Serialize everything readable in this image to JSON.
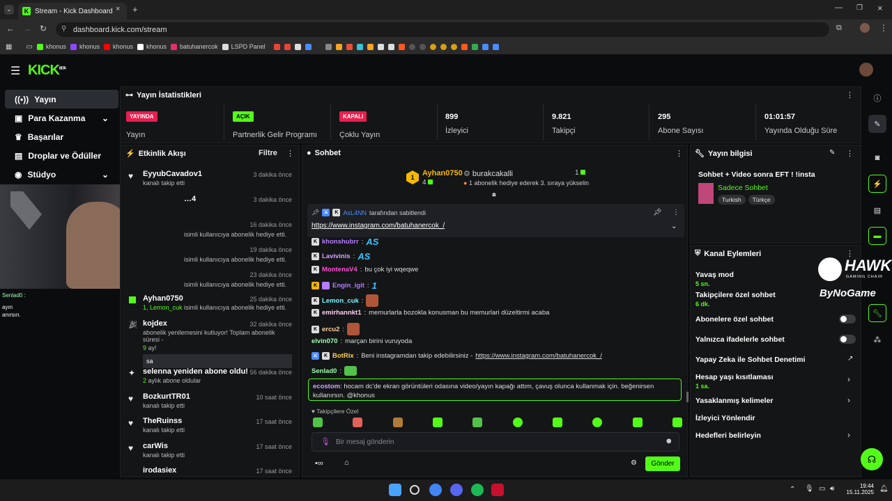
{
  "browser": {
    "tab_title": "Stream - Kick Dashboard",
    "url": "dashboard.kick.com/stream",
    "bookmarks": [
      "khonus",
      "khonus",
      "khonus",
      "khonus",
      "batuhanercok",
      "LSPD Panel"
    ]
  },
  "brand": {
    "logo": "KICK",
    "beta": "BETA"
  },
  "sidebar": {
    "items": [
      {
        "label": "Yayın",
        "icon": "broadcast-icon"
      },
      {
        "label": "Para Kazanma",
        "icon": "money-icon"
      },
      {
        "label": "Başarılar",
        "icon": "trophy-icon"
      },
      {
        "label": "Droplar ve Ödüller",
        "icon": "gift-icon"
      },
      {
        "label": "Stüdyo",
        "icon": "studio-icon"
      }
    ]
  },
  "stats": {
    "title": "Yayın İstatistikleri",
    "items": [
      {
        "badge": "YAYINDA",
        "label": "Yayın",
        "color": "#e91e4f"
      },
      {
        "badge": "AÇIK",
        "label": "Partnerlik Gelir Programı",
        "color": "#53fc18"
      },
      {
        "badge": "KAPALI",
        "label": "Çoklu Yayın",
        "color": "#e91e4f"
      },
      {
        "value": "899",
        "label": "İzleyici"
      },
      {
        "value": "9.821",
        "label": "Takipçi"
      },
      {
        "value": "295",
        "label": "Abone Sayısı"
      },
      {
        "value": "01:01:57",
        "label": "Yayında Olduğu Süre"
      }
    ]
  },
  "activity": {
    "title": "Etkinlik Akışı",
    "filter": "Filtre",
    "items": [
      {
        "name": "EyyubCavadov1",
        "time": "3 dakika önce",
        "sub": "kanalı takip etti"
      },
      {
        "name": "…4",
        "time": "3 dakika önce",
        "sub": ""
      },
      {
        "name": "",
        "time": "16 dakika önce",
        "sub": "isimli kullanıcıya abonelik hediye etti."
      },
      {
        "name": "",
        "time": "19 dakika önce",
        "sub": "isimli kullanıcıya abonelik hediye etti."
      },
      {
        "name": "",
        "time": "23 dakika önce",
        "sub": "isimli kullanıcıya abonelik hediye etti."
      },
      {
        "name": "Ayhan0750",
        "time": "25 dakika önce",
        "sub_green": "1, Lemon_cuk",
        "sub": " isimli kullanıcıya abonelik hediye etti."
      },
      {
        "name": "kojdex",
        "time": "32 dakika önce",
        "sub": "abonelik yenilemesini kutluyor! Toplam abonelik süresi -",
        "sub2_green": "9",
        "sub2": " ay!",
        "message": "sa"
      },
      {
        "name": "selenna yeniden abone oldu!",
        "time": "56 dakika önce",
        "sub_green": "2",
        "sub": " aylık abone oldular"
      },
      {
        "name": "BozkurtTR01",
        "time": "10 saat önce",
        "sub": "kanalı takip etti"
      },
      {
        "name": "TheRuinss",
        "time": "17 saat önce",
        "sub": "kanalı takip etti"
      },
      {
        "name": "carWis",
        "time": "17 saat önce",
        "sub": "kanalı takip etti"
      },
      {
        "name": "irodasiex",
        "time": "17 saat önce",
        "sub": ""
      }
    ]
  },
  "chat": {
    "title": "Sohbet",
    "top_gifter": {
      "name": "Ayhan0750",
      "count": "4",
      "rank": "1"
    },
    "second": {
      "name": "burakcakalli",
      "count": "1",
      "note": "1 abonelik hediye ederek 3. sıraya yükselin"
    },
    "pinned": {
      "by": "AsL4NN",
      "by_text": "tarafından sabitlendi",
      "link": "https://www.instagram.com/batuhanercok_/"
    },
    "messages": [
      {
        "user": "khonshubrr",
        "color": "#b57cff",
        "text": "AS"
      },
      {
        "user": "Lavivinis",
        "color": "#d4a3ff",
        "text": "AS"
      },
      {
        "user": "MontenaV4",
        "color": "#ff4dd2",
        "text": "bu çok iyi wqeqwe"
      },
      {
        "user": "Engin_igit",
        "color": "#b57cff",
        "text": "1"
      },
      {
        "user": "Lemon_cuk",
        "color": "#7cf5ff",
        "text": ""
      },
      {
        "user": "emirhannkt1",
        "color": "#ffd1f0",
        "text": "memurlarla bozokla konusman bu memurlari düzeltirmi acaba"
      },
      {
        "user": "ercu2",
        "color": "#ffcf9c",
        "text": ""
      },
      {
        "user": "elvin070",
        "color": "#9cffb0",
        "text": "marçan birini vuruyoda"
      },
      {
        "user": "BotRix",
        "color": "#ffd24d",
        "text": "Beni instagramdan takip edebilirsiniz -",
        "link": "https://www.instagram.com/batuhanercok_/"
      },
      {
        "user": "Senlad0",
        "color": "#9cffb0",
        "text": ""
      }
    ],
    "highlight": {
      "user": "ecostom",
      "text": "hocam dc'de ekran görüntüleri odasına video/yayın kapağı attım, çavuş olunca kullanmak için. beğenirsen kullanırsın. @khonus"
    },
    "followers_only": "Takipçilere Özel",
    "placeholder": "Bir mesaj gönderin",
    "send": "Gönder"
  },
  "stream_info": {
    "title": "Yayın bilgisi",
    "stream_title": "Sohbet + Video sonra EFT ! !insta",
    "category": "Sadece Sohbet",
    "tags": [
      "Turkish",
      "Türkçe"
    ]
  },
  "channel_actions": {
    "title": "Kanal Eylemleri",
    "items": [
      {
        "label": "Yavaş mod",
        "value": "5 sn."
      },
      {
        "label": "Takipçilere özel sohbet",
        "value": "6 dk."
      },
      {
        "label": "Abonelere özel sohbet",
        "toggle": false
      },
      {
        "label": "Yalnızca ifadelerle sohbet",
        "toggle": false
      },
      {
        "label": "Yapay Zeka ile Sohbet Denetimi"
      },
      {
        "label": "Hesap yaşı kısıtlaması",
        "value": "1 sa."
      },
      {
        "label": "Yasaklanmış kelimeler"
      },
      {
        "label": "İzleyici Yönlendir"
      },
      {
        "label": "Hedefleri belirleyin"
      }
    ]
  },
  "overlay": {
    "left_text_1": "Senlad0 :",
    "left_text_2": "ayın",
    "left_text_3": "anırsın.",
    "sponsor": "HAWK",
    "sponsor_sub": "GAMING CHAIR",
    "sponsor2": "ByNoGame"
  },
  "taskbar": {
    "time": "19:44",
    "date": "15.11.2025"
  }
}
